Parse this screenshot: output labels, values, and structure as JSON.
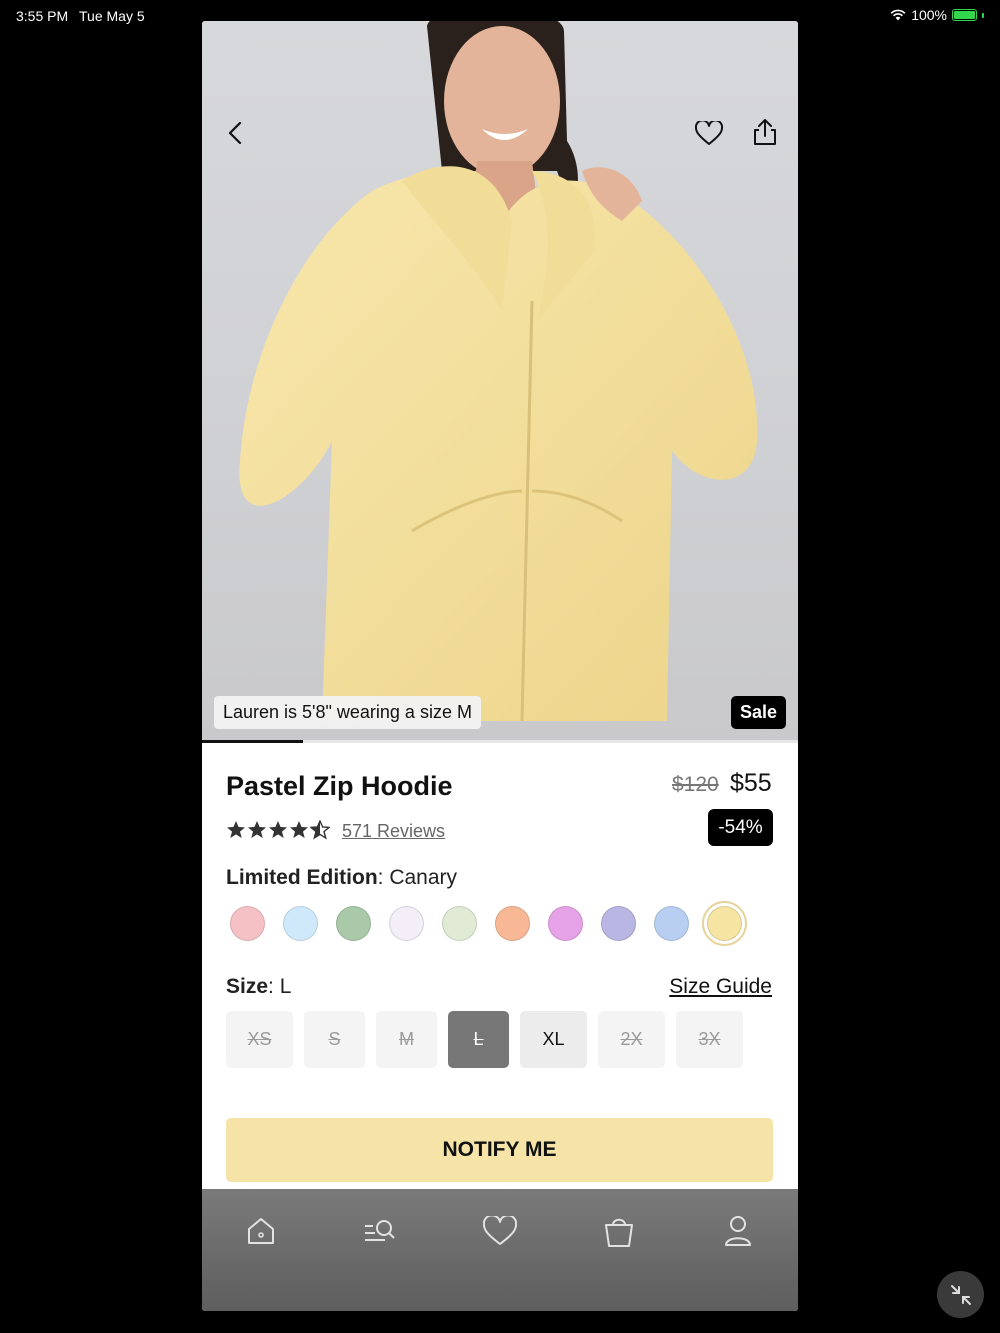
{
  "status_bar": {
    "time": "3:55 PM",
    "date": "Tue May 5",
    "battery": "100%"
  },
  "hero": {
    "caption": "Lauren is 5'8\" wearing a size M",
    "badge": "Sale",
    "image_index_progress": 0.17
  },
  "product": {
    "title": "Pastel Zip Hoodie",
    "price_original": "$120",
    "price_sale": "$55",
    "discount": "-54%",
    "rating": 4.5,
    "reviews_text": "571 Reviews"
  },
  "color": {
    "label": "Limited Edition",
    "value": "Canary",
    "swatches": [
      "#f5c1c5",
      "#cfe9fb",
      "#a9c9a8",
      "#f3eef7",
      "#e1ead4",
      "#f8b896",
      "#e6a2e6",
      "#b9b6e4",
      "#b8cff2",
      "#f6e4a3"
    ],
    "selected_index": 9
  },
  "size": {
    "label": "Size",
    "value": "L",
    "guide": "Size Guide",
    "options": [
      {
        "label": "XS",
        "state": "unavailable"
      },
      {
        "label": "S",
        "state": "unavailable"
      },
      {
        "label": "M",
        "state": "unavailable"
      },
      {
        "label": "L",
        "state": "selected-unavailable"
      },
      {
        "label": "XL",
        "state": "available"
      },
      {
        "label": "2X",
        "state": "unavailable"
      },
      {
        "label": "3X",
        "state": "unavailable"
      }
    ]
  },
  "cta": {
    "label": "NOTIFY ME"
  },
  "tabbar": {
    "items": [
      "home-icon",
      "search-menu-icon",
      "heart-icon",
      "bag-icon",
      "profile-icon"
    ]
  },
  "colors": {
    "accent_button": "#f5e3a8",
    "hoodie": "#f6e3a0"
  }
}
